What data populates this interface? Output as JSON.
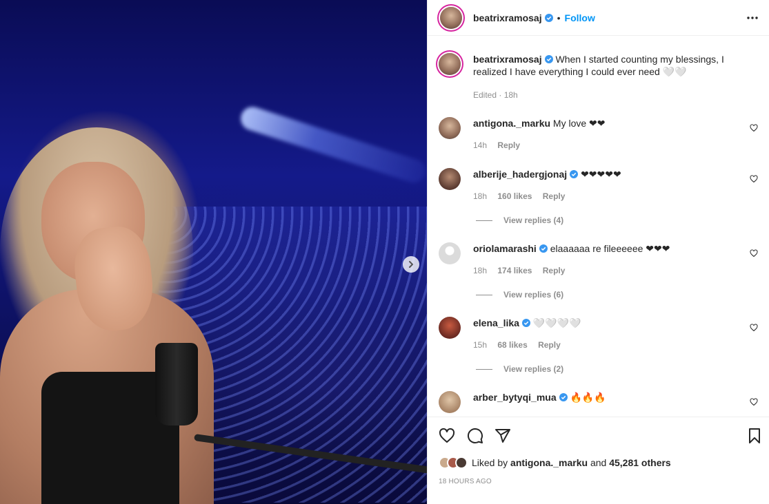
{
  "post": {
    "author": "beatrixramosaj",
    "follow_label": "Follow",
    "separator": "•",
    "caption": "When I started counting my blessings, I realized I have everything I could ever need 🤍🤍",
    "caption_meta": "Edited · 18h"
  },
  "comments": [
    {
      "user": "antigona._marku",
      "verified": false,
      "text": "My love ❤❤",
      "time": "14h",
      "likes": "",
      "reply": "Reply",
      "view_replies": ""
    },
    {
      "user": "alberije_hadergjonaj",
      "verified": true,
      "text": "❤❤❤❤❤",
      "time": "18h",
      "likes": "160 likes",
      "reply": "Reply",
      "view_replies": "View replies (4)"
    },
    {
      "user": "oriolamarashi",
      "verified": true,
      "text": "elaaaaaa re fileeeeee ❤❤❤",
      "time": "18h",
      "likes": "174 likes",
      "reply": "Reply",
      "view_replies": "View replies (6)"
    },
    {
      "user": "elena_lika",
      "verified": true,
      "text": "🤍🤍🤍🤍",
      "time": "15h",
      "likes": "68 likes",
      "reply": "Reply",
      "view_replies": "View replies (2)"
    },
    {
      "user": "arber_bytyqi_mua",
      "verified": true,
      "text": "🔥🔥🔥",
      "time": "",
      "likes": "",
      "reply": "",
      "view_replies": ""
    }
  ],
  "footer": {
    "liked_by_prefix": "Liked by",
    "liked_by_user": "antigona._marku",
    "liked_by_suffix": "and 45,281 others",
    "time_ago": "18 HOURS AGO"
  },
  "icons": [
    "verified-badge-icon",
    "more-options-icon",
    "heart-icon",
    "comment-icon",
    "share-icon",
    "bookmark-icon",
    "next-arrow-icon"
  ],
  "colors": {
    "accent": "#0095f6",
    "verified": "#3897f0",
    "muted": "#8e8e8e"
  }
}
